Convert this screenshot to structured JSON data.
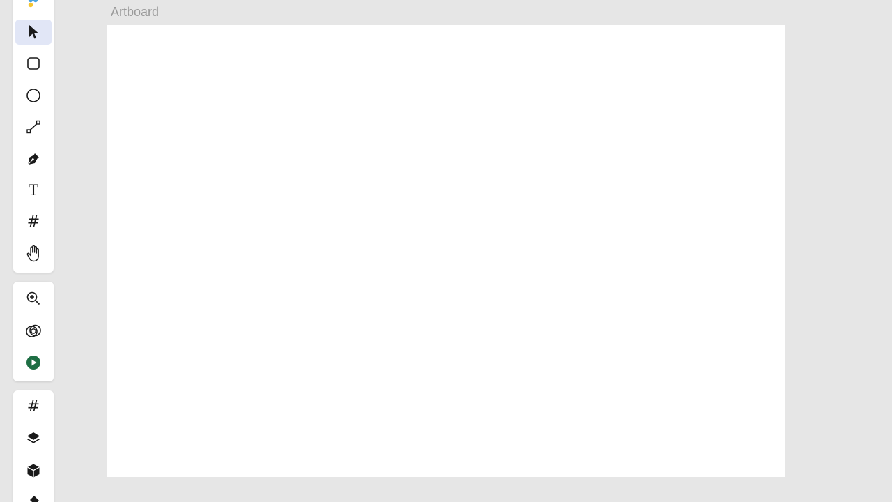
{
  "canvas": {
    "artboard_label": "Artboard",
    "artboard_color": "#ffffff",
    "background_color": "#e6e6e6"
  },
  "toolbar": {
    "tools": [
      {
        "id": "logo",
        "icon": "app-logo-icon",
        "active": false
      },
      {
        "id": "select",
        "icon": "cursor-icon",
        "active": true
      },
      {
        "id": "rectangle",
        "icon": "rectangle-icon",
        "active": false
      },
      {
        "id": "ellipse",
        "icon": "ellipse-icon",
        "active": false
      },
      {
        "id": "line",
        "icon": "line-icon",
        "active": false
      },
      {
        "id": "pen",
        "icon": "pen-icon",
        "active": false
      },
      {
        "id": "text",
        "icon": "text-icon",
        "active": false,
        "glyph": "T"
      },
      {
        "id": "grid",
        "icon": "grid-hash-icon",
        "active": false,
        "glyph": "#"
      },
      {
        "id": "hand",
        "icon": "hand-icon",
        "active": false
      }
    ],
    "active_color": "#e1e6f6"
  },
  "view_tools": {
    "tools": [
      {
        "id": "zoom",
        "icon": "zoom-in-icon"
      },
      {
        "id": "boolean",
        "icon": "boolean-ops-icon"
      },
      {
        "id": "preview",
        "icon": "play-circle-icon",
        "color": "#1e6e44"
      }
    ]
  },
  "side_tools": {
    "tools": [
      {
        "id": "frames",
        "icon": "hash-icon",
        "glyph": "#"
      },
      {
        "id": "layers",
        "icon": "layers-icon"
      },
      {
        "id": "components",
        "icon": "cube-icon"
      },
      {
        "id": "more",
        "icon": "eraser-icon"
      }
    ]
  }
}
